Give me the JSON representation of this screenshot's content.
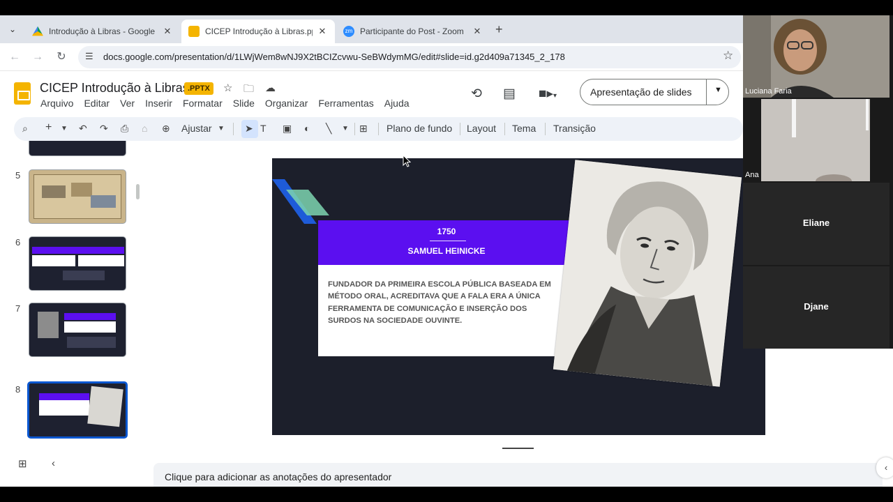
{
  "browser": {
    "tabs": [
      {
        "title": "Introdução à Libras - Google Dr",
        "favicon": "google-drive-icon",
        "active": false
      },
      {
        "title": "CICEP Introdução à Libras.pptx",
        "favicon": "google-slides-icon",
        "active": true
      },
      {
        "title": "Participante do Post - Zoom",
        "favicon": "zoom-icon",
        "active": false
      }
    ],
    "url": "docs.google.com/presentation/d/1LWjWem8wNJ9X2tBCIZcvwu-SeBWdymMG/edit#slide=id.g2d409a71345_2_178"
  },
  "doc": {
    "title": "CICEP Introdução à Libras",
    "badge": ".PPTX",
    "menu": [
      "Arquivo",
      "Editar",
      "Ver",
      "Inserir",
      "Formatar",
      "Slide",
      "Organizar",
      "Ferramentas",
      "Ajuda"
    ],
    "present_label": "Apresentação de slides"
  },
  "toolbar": {
    "zoom_label": "Ajustar",
    "background_label": "Plano de fundo",
    "layout_label": "Layout",
    "theme_label": "Tema",
    "transition_label": "Transição"
  },
  "filmstrip": {
    "slides": [
      {
        "number": "5",
        "selected": false
      },
      {
        "number": "6",
        "selected": false
      },
      {
        "number": "7",
        "selected": false
      },
      {
        "number": "8",
        "selected": true
      }
    ]
  },
  "slide": {
    "year": "1750",
    "name": "SAMUEL HEINICKE",
    "body": "FUNDADOR DA PRIMEIRA ESCOLA PÚBLICA BASEADA EM MÉTODO ORAL, ACREDITAVA QUE A FALA ERA A ÚNICA FERRAMENTA DE COMUNICAÇÃO E INSERÇÃO DOS SURDOS NA SOCIEDADE OUVINTE."
  },
  "notes": {
    "placeholder": "Clique para adicionar as anotações do apresentador"
  },
  "zoom": {
    "participants": [
      "Luciana Faria",
      "Ana",
      "Eliane",
      "Djane"
    ]
  },
  "colors": {
    "accent_purple": "#5b0ff0",
    "slide_bg": "#1c1f2b",
    "slides_yellow": "#f4b400",
    "selection_blue": "#0b57d0"
  }
}
